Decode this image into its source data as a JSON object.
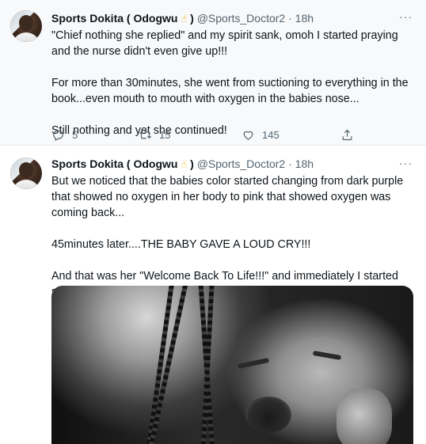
{
  "tweets": [
    {
      "display_name": "Sports Dokita ( Odogwu",
      "emoji": "☝",
      "name_suffix": ")",
      "handle": "@Sports_Doctor2",
      "separator": "·",
      "time": "18h",
      "more": "···",
      "paragraphs": [
        "\"Chief nothing she replied\" and my spirit sank, omoh I started praying and the nurse didn't even give up!!!",
        "For more than 30minutes, she went from suctioning to everything in the book...even mouth to mouth with oxygen in the babies nose...",
        "Still nothing and yet she continued!"
      ],
      "actions": {
        "reply_count": "5",
        "retweet_count": "15",
        "like_count": "145"
      }
    },
    {
      "display_name": "Sports Dokita ( Odogwu",
      "emoji": "☝",
      "name_suffix": ")",
      "handle": "@Sports_Doctor2",
      "separator": "·",
      "time": "18h",
      "more": "···",
      "paragraphs": [
        "But we noticed that the babies color started changing from dark purple that showed no oxygen in her body to pink that showed oxygen was coming back...",
        "45minutes later....THE BABY GAVE A LOUD CRY!!!",
        "And that was her \"Welcome Back To Life!!!\" and immediately I started singing..."
      ]
    }
  ],
  "icons": {
    "reply": "reply-icon",
    "retweet": "retweet-icon",
    "like": "heart-icon",
    "share": "share-icon",
    "more": "more-icon"
  },
  "colors": {
    "secondary_text": "#536471",
    "primary_text": "#0f1419",
    "tweet_hover_bg": "#f7f9fa",
    "emoji": "#f4b400"
  }
}
